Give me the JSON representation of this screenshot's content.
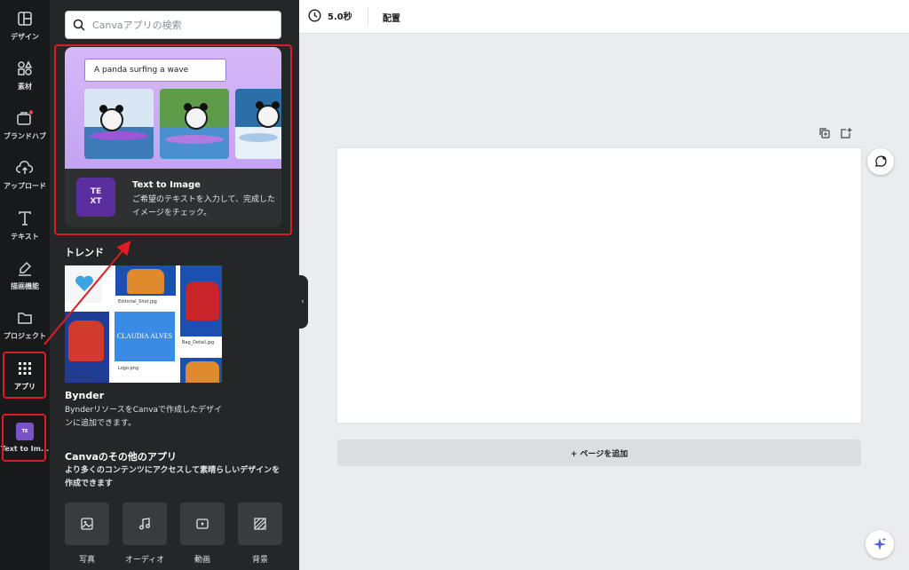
{
  "rail": {
    "items": [
      {
        "label": "デザイン",
        "icon": "layout-icon"
      },
      {
        "label": "素材",
        "icon": "elements-icon"
      },
      {
        "label": "ブランドハブ",
        "icon": "brand-icon"
      },
      {
        "label": "アップロード",
        "icon": "upload-icon"
      },
      {
        "label": "テキスト",
        "icon": "text-icon"
      },
      {
        "label": "描画機能",
        "icon": "draw-icon"
      },
      {
        "label": "プロジェクト",
        "icon": "folder-icon"
      },
      {
        "label": "アプリ",
        "icon": "apps-grid-icon"
      },
      {
        "label": "Text to Im...",
        "icon": "text-to-image-app-icon"
      }
    ]
  },
  "search": {
    "placeholder": "Canvaアプリの検索"
  },
  "featured": {
    "prompt": "A panda surfing a wave",
    "logo_text": "TE\nXT",
    "title": "Text to Image",
    "description": "ご希望のテキストを入力して、完成したイメージをチェック。"
  },
  "trend": {
    "section_title": "トレンド",
    "captions": [
      "Editorial_Shot.jpg",
      "Bag_Detail.jpg",
      "Logo.png",
      "ct_Shot.jpg"
    ],
    "logo_text": "CLAUDIA ALVES",
    "app_title": "Bynder",
    "app_desc": "BynderリソースをCanvaで作成したデザインに追加できます。"
  },
  "other_apps": {
    "section_title": "Canvaのその他のアプリ",
    "description": "より多くのコンテンツにアクセスして素晴らしいデザインを作成できます",
    "categories": [
      {
        "label": "写真",
        "icon": "photo-icon"
      },
      {
        "label": "オーディオ",
        "icon": "music-note-icon"
      },
      {
        "label": "動画",
        "icon": "video-icon"
      },
      {
        "label": "背景",
        "icon": "background-pattern-icon"
      }
    ]
  },
  "topbar": {
    "duration": "5.0秒",
    "arrange": "配置"
  },
  "canvas": {
    "add_page": "+ ページを追加"
  },
  "colors": {
    "panel_bg": "#252627",
    "rail_bg": "#18191b",
    "annotation_red": "#d91d24",
    "tti_purple": "#c4a3f2"
  }
}
